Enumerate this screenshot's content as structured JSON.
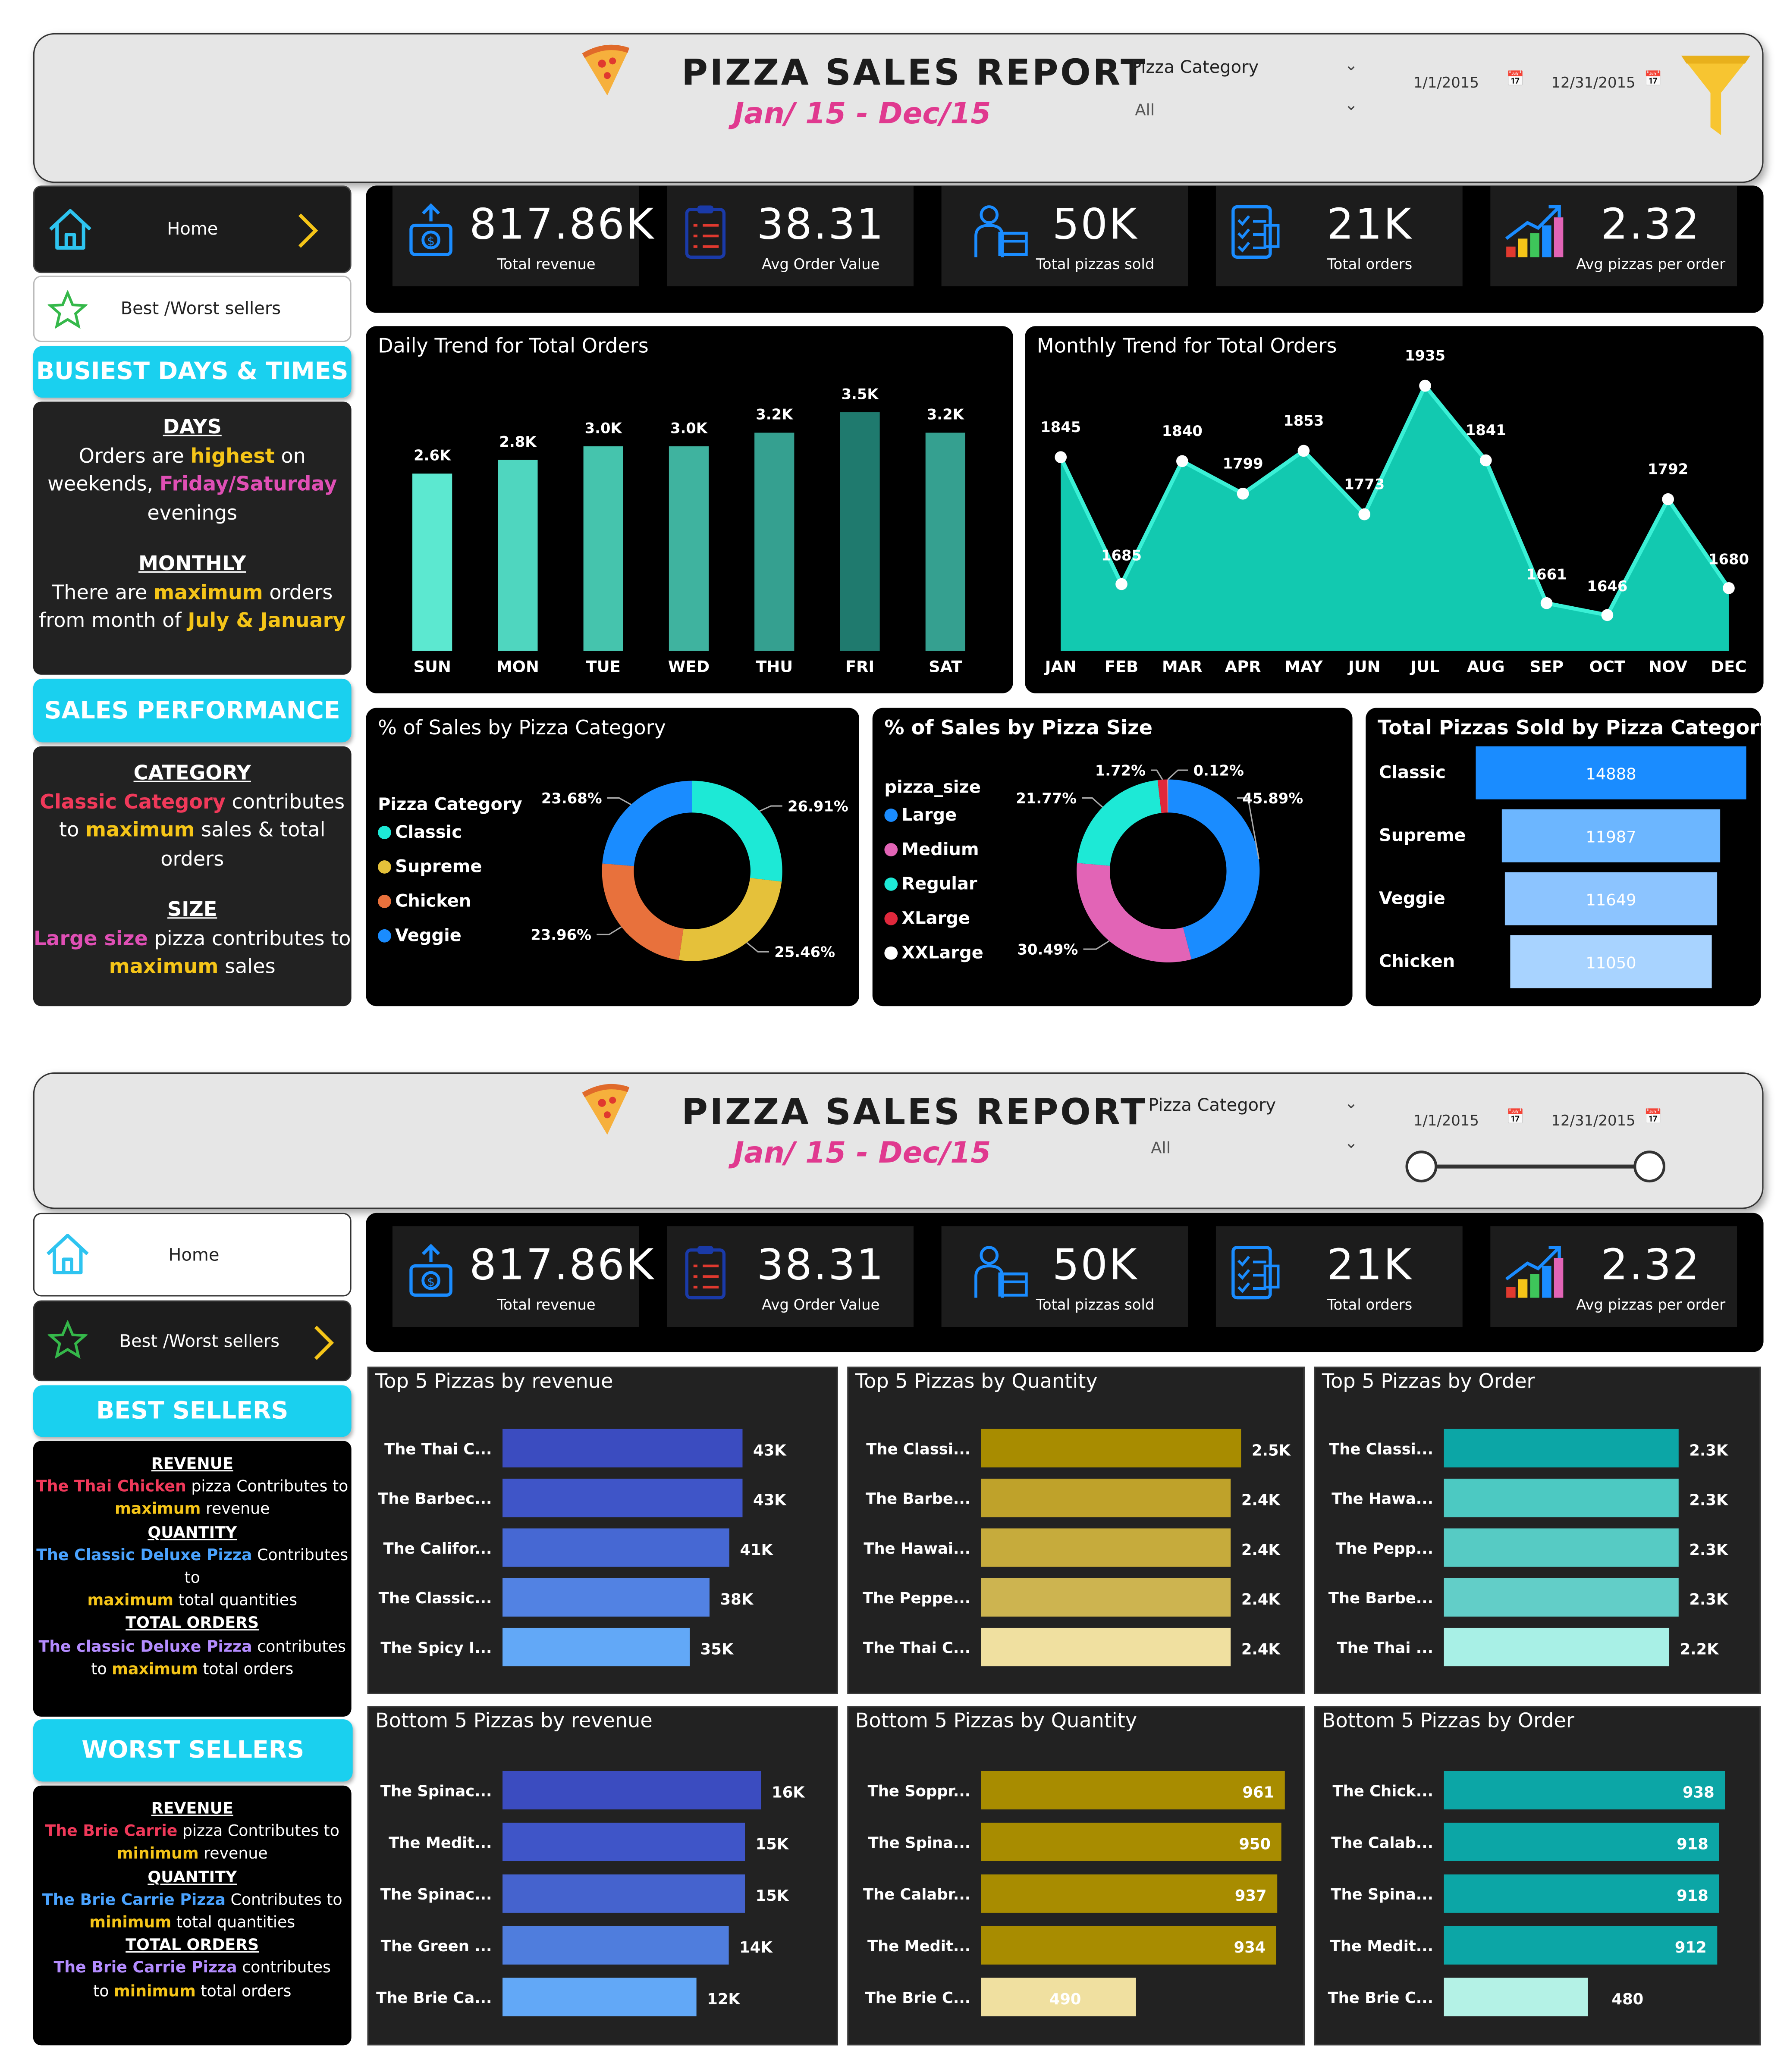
{
  "report": {
    "title": "PIZZA SALES REPORT",
    "subtitle": "Jan/ 15 - Dec/15",
    "filter_label": "Pizza Category",
    "filter_value": "All",
    "date_start": "1/1/2015",
    "date_end": "12/31/2015"
  },
  "nav": {
    "home": "Home",
    "best_worst": "Best /Worst sellers"
  },
  "kpis": [
    {
      "value": "817.86K",
      "label": "Total revenue",
      "icon": "revenue-icon"
    },
    {
      "value": "38.31",
      "label": "Avg Order Value",
      "icon": "clipboard-icon"
    },
    {
      "value": "50K",
      "label": "Total pizzas sold",
      "icon": "delivery-icon"
    },
    {
      "value": "21K",
      "label": "Total orders",
      "icon": "checklist-icon"
    },
    {
      "value": "2.32",
      "label": "Avg pizzas per order",
      "icon": "growth-chart-icon"
    }
  ],
  "page1": {
    "busiest_header": "BUSIEST DAYS & TIMES",
    "days_head": "DAYS",
    "days_l1a": "Orders are ",
    "days_l1b": "highest",
    "days_l1c": " on",
    "days_l2a": "weekends, ",
    "days_l2b": "Friday/Saturday",
    "days_l3": "evenings",
    "monthly_head": "MONTHLY",
    "monthly_l1a": "There are ",
    "monthly_l1b": "maximum",
    "monthly_l1c": " orders",
    "monthly_l2a": "from month of ",
    "monthly_l2b": "July & January",
    "sales_header": "SALES PERFORMANCE",
    "cat_head": "CATEGORY",
    "cat_l1a": "Classic Category",
    "cat_l1b": " contributes",
    "cat_l2a": "to ",
    "cat_l2b": "maximum",
    "cat_l2c": " sales & total",
    "cat_l3": "orders",
    "size_head": "SIZE",
    "size_l1a": "Large size",
    "size_l1b": " pizza contributes to",
    "size_l2a": "maximum",
    "size_l2b": " sales"
  },
  "page2": {
    "best_header": "BEST SELLERS",
    "worst_header": "WORST SELLERS",
    "best": {
      "rev_head": "REVENUE",
      "rev_a": "The Thai Chicken",
      "rev_b": " pizza Contributes to",
      "rev_c": "maximum",
      "rev_d": " revenue",
      "qty_head": "QUANTITY",
      "qty_a": "The Classic Deluxe Pizza",
      "qty_b": " Contributes to",
      "qty_c": "maximum",
      "qty_d": " total quantities",
      "ord_head": "TOTAL ORDERS",
      "ord_a": "The classic Deluxe Pizza",
      "ord_b": " contributes",
      "ord_c": "to ",
      "ord_d": "maximum",
      "ord_e": " total orders"
    },
    "worst": {
      "rev_head": "REVENUE",
      "rev_a": "The Brie Carrie",
      "rev_b": " pizza Contributes to",
      "rev_c": "minimum",
      "rev_d": " revenue",
      "qty_head": "QUANTITY",
      "qty_a": "The Brie Carrie Pizza",
      "qty_b": " Contributes to",
      "qty_c": "minimum",
      "qty_d": " total quantities",
      "ord_head": "TOTAL ORDERS",
      "ord_a": "The Brie Carrie Pizza",
      "ord_b": " contributes",
      "ord_c": "to ",
      "ord_d": "minimum",
      "ord_e": " total orders"
    }
  },
  "chart_data": [
    {
      "id": "daily",
      "type": "bar",
      "title": "Daily Trend for Total Orders",
      "categories": [
        "SUN",
        "MON",
        "TUE",
        "WED",
        "THU",
        "FRI",
        "SAT"
      ],
      "values": [
        2.6,
        2.8,
        3.0,
        3.0,
        3.2,
        3.5,
        3.2
      ],
      "labels": [
        "2.6K",
        "2.8K",
        "3.0K",
        "3.0K",
        "3.2K",
        "3.5K",
        "3.2K"
      ],
      "colors": [
        "#5ce8d0",
        "#4fd6bf",
        "#45c4ad",
        "#3fb39f",
        "#35a090",
        "#1f7a6e",
        "#35a090"
      ]
    },
    {
      "id": "monthly",
      "type": "area",
      "title": "Monthly Trend for Total Orders",
      "categories": [
        "JAN",
        "FEB",
        "MAR",
        "APR",
        "MAY",
        "JUN",
        "JUL",
        "AUG",
        "SEP",
        "OCT",
        "NOV",
        "DEC"
      ],
      "values": [
        1845,
        1685,
        1840,
        1799,
        1853,
        1773,
        1935,
        1841,
        1661,
        1646,
        1792,
        1680
      ],
      "color": "#12c9b0"
    },
    {
      "id": "cat_pct",
      "type": "pie",
      "title": "% of Sales by Pizza Category",
      "legend_title": "Pizza Category",
      "labels": [
        "Classic",
        "Supreme",
        "Chicken",
        "Veggie"
      ],
      "values": [
        26.91,
        25.46,
        23.96,
        23.68
      ],
      "value_labels": [
        "26.91%",
        "25.46%",
        "23.96%",
        "23.68%"
      ],
      "colors": [
        "#1de9d6",
        "#e5c13a",
        "#e8713c",
        "#1a8cff"
      ]
    },
    {
      "id": "size_pct",
      "type": "pie",
      "title": "% of Sales by Pizza Size",
      "legend_title": "pizza_size",
      "labels": [
        "Large",
        "Medium",
        "Regular",
        "XLarge",
        "XXLarge"
      ],
      "values": [
        45.89,
        30.49,
        21.77,
        1.72,
        0.12
      ],
      "value_labels": [
        "45.89%",
        "30.49%",
        "21.77%",
        "1.72%",
        "0.12%"
      ],
      "colors": [
        "#1a8cff",
        "#e264b6",
        "#1de9d6",
        "#e0283c",
        "#ffffff"
      ]
    },
    {
      "id": "cat_sold",
      "type": "bar",
      "title": "Total Pizzas Sold by Pizza Category",
      "categories": [
        "Classic",
        "Supreme",
        "Veggie",
        "Chicken"
      ],
      "values": [
        14888,
        11987,
        11649,
        11050
      ],
      "colors": [
        "#1a8cff",
        "#6cb6ff",
        "#8cc4ff",
        "#a8d3ff"
      ]
    },
    {
      "id": "top_rev",
      "type": "bar",
      "title": "Top 5 Pizzas by revenue",
      "categories": [
        "The Thai C...",
        "The Barbec...",
        "The Califor...",
        "The Classic...",
        "The Spicy I..."
      ],
      "values": [
        43,
        43,
        41,
        38,
        35
      ],
      "labels": [
        "43K",
        "43K",
        "41K",
        "38K",
        "35K"
      ],
      "colors": [
        "#3b4cc0",
        "#3f55c8",
        "#4668d3",
        "#5282e3",
        "#62a8f7"
      ]
    },
    {
      "id": "top_qty",
      "type": "bar",
      "title": "Top 5 Pizzas by Quantity",
      "categories": [
        "The Classi...",
        "The Barbe...",
        "The Hawai...",
        "The Peppe...",
        "The Thai C..."
      ],
      "values": [
        2.5,
        2.4,
        2.4,
        2.4,
        2.4
      ],
      "labels": [
        "2.5K",
        "2.4K",
        "2.4K",
        "2.4K",
        "2.4K"
      ],
      "colors": [
        "#a88c00",
        "#bfa22a",
        "#c6ab3c",
        "#cdb450",
        "#f0e0a0"
      ]
    },
    {
      "id": "top_ord",
      "type": "bar",
      "title": "Top 5 Pizzas by Order",
      "categories": [
        "The Classi...",
        "The Hawa...",
        "The Pepp...",
        "The Barbe...",
        "The Thai ..."
      ],
      "values": [
        2.3,
        2.3,
        2.3,
        2.3,
        2.2
      ],
      "labels": [
        "2.3K",
        "2.3K",
        "2.3K",
        "2.3K",
        "2.2K"
      ],
      "colors": [
        "#0ca6a6",
        "#4cc9c2",
        "#56cbc4",
        "#62cec8",
        "#a8f0e6"
      ]
    },
    {
      "id": "bot_rev",
      "type": "bar",
      "title": "Bottom 5 Pizzas by revenue",
      "categories": [
        "The Spinac...",
        "The Medit...",
        "The Spinac...",
        "The Green ...",
        "The Brie Ca..."
      ],
      "values": [
        16,
        15,
        15,
        14,
        12
      ],
      "labels": [
        "16K",
        "15K",
        "15K",
        "14K",
        "12K"
      ],
      "colors": [
        "#3b4cc0",
        "#3f55c8",
        "#4563ce",
        "#4f7ddd",
        "#62a8f7"
      ]
    },
    {
      "id": "bot_qty",
      "type": "bar",
      "title": "Bottom 5 Pizzas by Quantity",
      "categories": [
        "The Soppr...",
        "The Spina...",
        "The Calabr...",
        "The Medit...",
        "The Brie C..."
      ],
      "values": [
        961,
        950,
        937,
        934,
        490
      ],
      "labels": [
        "961",
        "950",
        "937",
        "934",
        "490"
      ],
      "colors": [
        "#a88c00",
        "#a88c00",
        "#a88c00",
        "#a88c00",
        "#f0e0a0"
      ]
    },
    {
      "id": "bot_ord",
      "type": "bar",
      "title": "Bottom 5 Pizzas by Order",
      "categories": [
        "The Chick...",
        "The Calab...",
        "The Spina...",
        "The Medit...",
        "The Brie C..."
      ],
      "values": [
        938,
        918,
        918,
        912,
        480
      ],
      "labels": [
        "938",
        "918",
        "918",
        "912",
        "480"
      ],
      "colors": [
        "#0ca6a6",
        "#0ca6a6",
        "#0ca6a6",
        "#0ca6a6",
        "#b4f2e6"
      ]
    }
  ]
}
